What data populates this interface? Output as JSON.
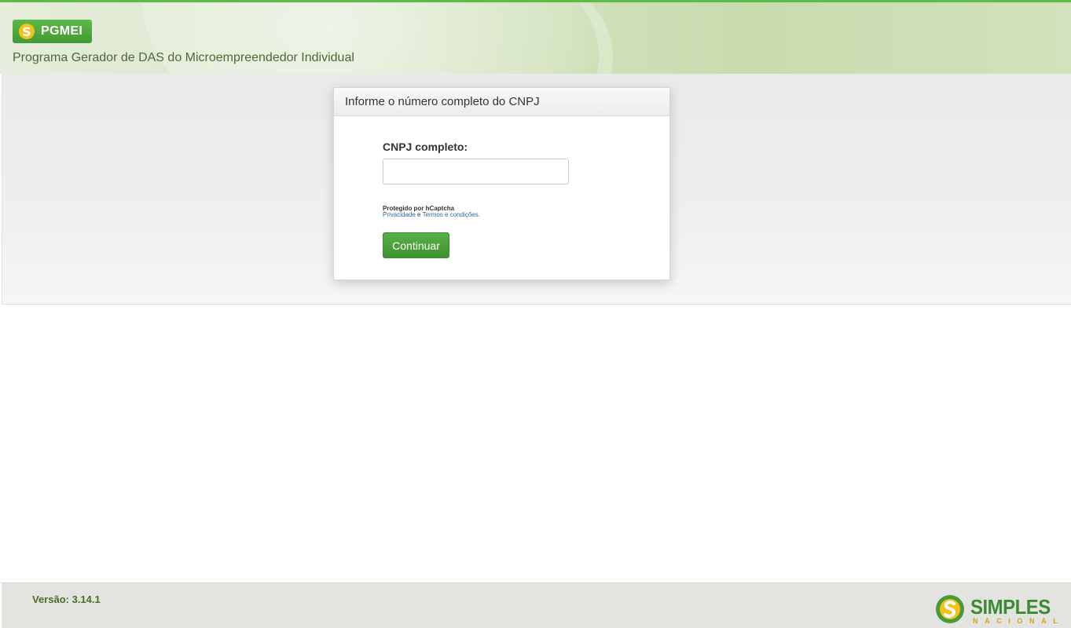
{
  "header": {
    "brand_name": "PGMEI",
    "logo_glyph": "S",
    "subtitle": "Programa Gerador de DAS do Microempreendedor Individual"
  },
  "card": {
    "title": "Informe o número completo do CNPJ",
    "cnpj_label": "CNPJ completo:",
    "cnpj_value": "",
    "cnpj_placeholder": "",
    "captcha": {
      "protected_by": "Protegido por hCaptcha",
      "privacy_link": "Privacidade",
      "separator": "e",
      "terms_link": "Termos e condições."
    },
    "continue_label": "Continuar"
  },
  "footer": {
    "version_text": "Versão: 3.14.1",
    "logo_word": "SIMPLES",
    "logo_sub": "NACIONAL"
  },
  "colors": {
    "brand_green": "#4aa43b",
    "header_top_line": "#5dbb46",
    "logo_yellow": "#f2c21b",
    "link_blue": "#2d6a9f"
  },
  "icons": {
    "brand_logo": "simples-s-logo-icon",
    "footer_logo": "simples-nacional-logo-icon"
  }
}
